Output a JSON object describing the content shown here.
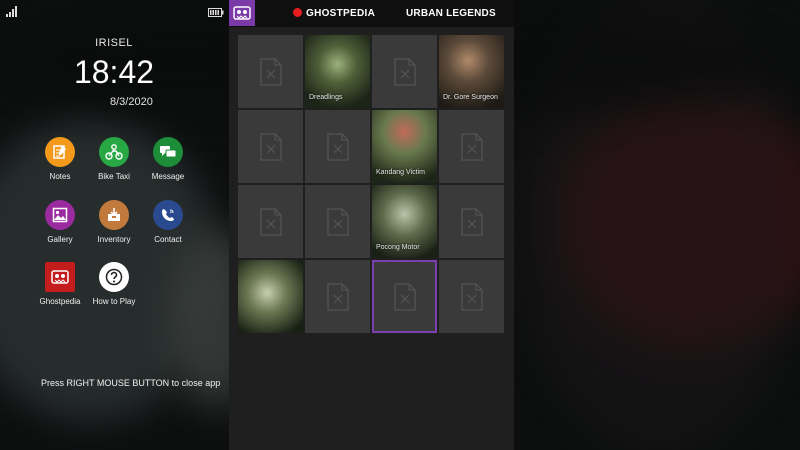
{
  "status": {
    "signal_icon": "signal-bars-icon",
    "battery_icon": "battery-icon"
  },
  "phone": {
    "carrier": "IRISEL",
    "time": "18:42",
    "date": "8/3/2020",
    "apps": [
      {
        "label": "Notes",
        "icon": "notes-icon",
        "color": "#f39a1d"
      },
      {
        "label": "Bike Taxi",
        "icon": "bike-taxi-icon",
        "color": "#27a844"
      },
      {
        "label": "Message",
        "icon": "message-icon",
        "color": "#1d8d3a"
      },
      {
        "label": "Gallery",
        "icon": "gallery-icon",
        "color": "#9b2a9f"
      },
      {
        "label": "Inventory",
        "icon": "inventory-icon",
        "color": "#c27a3c"
      },
      {
        "label": "Contact",
        "icon": "contact-icon",
        "color": "#2a4a8f"
      },
      {
        "label": "Ghostpedia",
        "icon": "ghostpedia-icon",
        "color": "#c41d1d"
      },
      {
        "label": "How to Play",
        "icon": "help-icon",
        "color": "#ffffff"
      }
    ],
    "hint": "Press RIGHT MOUSE BUTTON to close app"
  },
  "ghostpedia": {
    "brand_color": "#7a3aa8",
    "tabs": [
      {
        "label": "GHOSTPEDIA",
        "active": true
      },
      {
        "label": "URBAN LEGENDS",
        "active": false
      }
    ],
    "entries": [
      {
        "name": "",
        "unlocked": false
      },
      {
        "name": "Dreadlings",
        "unlocked": true
      },
      {
        "name": "",
        "unlocked": false
      },
      {
        "name": "Dr. Gore Surgeon",
        "unlocked": true
      },
      {
        "name": "",
        "unlocked": false
      },
      {
        "name": "",
        "unlocked": false
      },
      {
        "name": "Kandang Victim",
        "unlocked": true
      },
      {
        "name": "",
        "unlocked": false
      },
      {
        "name": "",
        "unlocked": false
      },
      {
        "name": "",
        "unlocked": false
      },
      {
        "name": "Pocong Motor",
        "unlocked": true
      },
      {
        "name": "",
        "unlocked": false
      },
      {
        "name": "",
        "unlocked": true
      },
      {
        "name": "",
        "unlocked": false
      },
      {
        "name": "",
        "unlocked": false,
        "selected": true
      },
      {
        "name": "",
        "unlocked": false
      }
    ]
  }
}
